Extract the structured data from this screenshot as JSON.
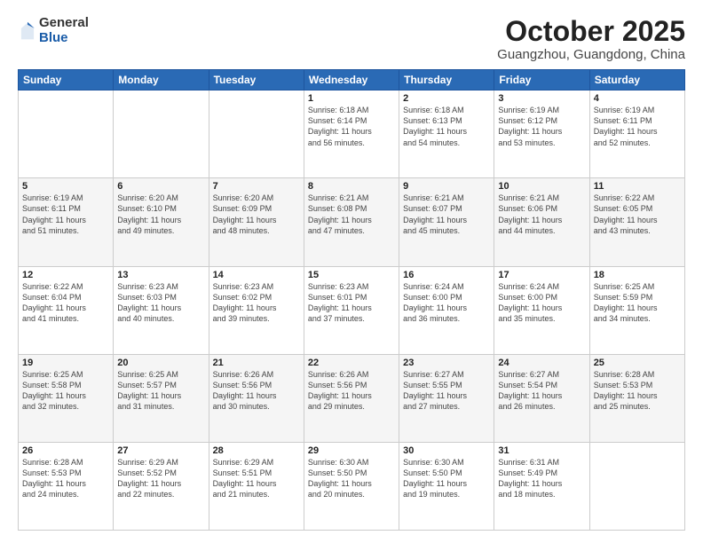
{
  "logo": {
    "general": "General",
    "blue": "Blue"
  },
  "title": {
    "month": "October 2025",
    "location": "Guangzhou, Guangdong, China"
  },
  "headers": [
    "Sunday",
    "Monday",
    "Tuesday",
    "Wednesday",
    "Thursday",
    "Friday",
    "Saturday"
  ],
  "weeks": [
    [
      {
        "num": "",
        "info": ""
      },
      {
        "num": "",
        "info": ""
      },
      {
        "num": "",
        "info": ""
      },
      {
        "num": "1",
        "info": "Sunrise: 6:18 AM\nSunset: 6:14 PM\nDaylight: 11 hours\nand 56 minutes."
      },
      {
        "num": "2",
        "info": "Sunrise: 6:18 AM\nSunset: 6:13 PM\nDaylight: 11 hours\nand 54 minutes."
      },
      {
        "num": "3",
        "info": "Sunrise: 6:19 AM\nSunset: 6:12 PM\nDaylight: 11 hours\nand 53 minutes."
      },
      {
        "num": "4",
        "info": "Sunrise: 6:19 AM\nSunset: 6:11 PM\nDaylight: 11 hours\nand 52 minutes."
      }
    ],
    [
      {
        "num": "5",
        "info": "Sunrise: 6:19 AM\nSunset: 6:11 PM\nDaylight: 11 hours\nand 51 minutes."
      },
      {
        "num": "6",
        "info": "Sunrise: 6:20 AM\nSunset: 6:10 PM\nDaylight: 11 hours\nand 49 minutes."
      },
      {
        "num": "7",
        "info": "Sunrise: 6:20 AM\nSunset: 6:09 PM\nDaylight: 11 hours\nand 48 minutes."
      },
      {
        "num": "8",
        "info": "Sunrise: 6:21 AM\nSunset: 6:08 PM\nDaylight: 11 hours\nand 47 minutes."
      },
      {
        "num": "9",
        "info": "Sunrise: 6:21 AM\nSunset: 6:07 PM\nDaylight: 11 hours\nand 45 minutes."
      },
      {
        "num": "10",
        "info": "Sunrise: 6:21 AM\nSunset: 6:06 PM\nDaylight: 11 hours\nand 44 minutes."
      },
      {
        "num": "11",
        "info": "Sunrise: 6:22 AM\nSunset: 6:05 PM\nDaylight: 11 hours\nand 43 minutes."
      }
    ],
    [
      {
        "num": "12",
        "info": "Sunrise: 6:22 AM\nSunset: 6:04 PM\nDaylight: 11 hours\nand 41 minutes."
      },
      {
        "num": "13",
        "info": "Sunrise: 6:23 AM\nSunset: 6:03 PM\nDaylight: 11 hours\nand 40 minutes."
      },
      {
        "num": "14",
        "info": "Sunrise: 6:23 AM\nSunset: 6:02 PM\nDaylight: 11 hours\nand 39 minutes."
      },
      {
        "num": "15",
        "info": "Sunrise: 6:23 AM\nSunset: 6:01 PM\nDaylight: 11 hours\nand 37 minutes."
      },
      {
        "num": "16",
        "info": "Sunrise: 6:24 AM\nSunset: 6:00 PM\nDaylight: 11 hours\nand 36 minutes."
      },
      {
        "num": "17",
        "info": "Sunrise: 6:24 AM\nSunset: 6:00 PM\nDaylight: 11 hours\nand 35 minutes."
      },
      {
        "num": "18",
        "info": "Sunrise: 6:25 AM\nSunset: 5:59 PM\nDaylight: 11 hours\nand 34 minutes."
      }
    ],
    [
      {
        "num": "19",
        "info": "Sunrise: 6:25 AM\nSunset: 5:58 PM\nDaylight: 11 hours\nand 32 minutes."
      },
      {
        "num": "20",
        "info": "Sunrise: 6:25 AM\nSunset: 5:57 PM\nDaylight: 11 hours\nand 31 minutes."
      },
      {
        "num": "21",
        "info": "Sunrise: 6:26 AM\nSunset: 5:56 PM\nDaylight: 11 hours\nand 30 minutes."
      },
      {
        "num": "22",
        "info": "Sunrise: 6:26 AM\nSunset: 5:56 PM\nDaylight: 11 hours\nand 29 minutes."
      },
      {
        "num": "23",
        "info": "Sunrise: 6:27 AM\nSunset: 5:55 PM\nDaylight: 11 hours\nand 27 minutes."
      },
      {
        "num": "24",
        "info": "Sunrise: 6:27 AM\nSunset: 5:54 PM\nDaylight: 11 hours\nand 26 minutes."
      },
      {
        "num": "25",
        "info": "Sunrise: 6:28 AM\nSunset: 5:53 PM\nDaylight: 11 hours\nand 25 minutes."
      }
    ],
    [
      {
        "num": "26",
        "info": "Sunrise: 6:28 AM\nSunset: 5:53 PM\nDaylight: 11 hours\nand 24 minutes."
      },
      {
        "num": "27",
        "info": "Sunrise: 6:29 AM\nSunset: 5:52 PM\nDaylight: 11 hours\nand 22 minutes."
      },
      {
        "num": "28",
        "info": "Sunrise: 6:29 AM\nSunset: 5:51 PM\nDaylight: 11 hours\nand 21 minutes."
      },
      {
        "num": "29",
        "info": "Sunrise: 6:30 AM\nSunset: 5:50 PM\nDaylight: 11 hours\nand 20 minutes."
      },
      {
        "num": "30",
        "info": "Sunrise: 6:30 AM\nSunset: 5:50 PM\nDaylight: 11 hours\nand 19 minutes."
      },
      {
        "num": "31",
        "info": "Sunrise: 6:31 AM\nSunset: 5:49 PM\nDaylight: 11 hours\nand 18 minutes."
      },
      {
        "num": "",
        "info": ""
      }
    ]
  ]
}
